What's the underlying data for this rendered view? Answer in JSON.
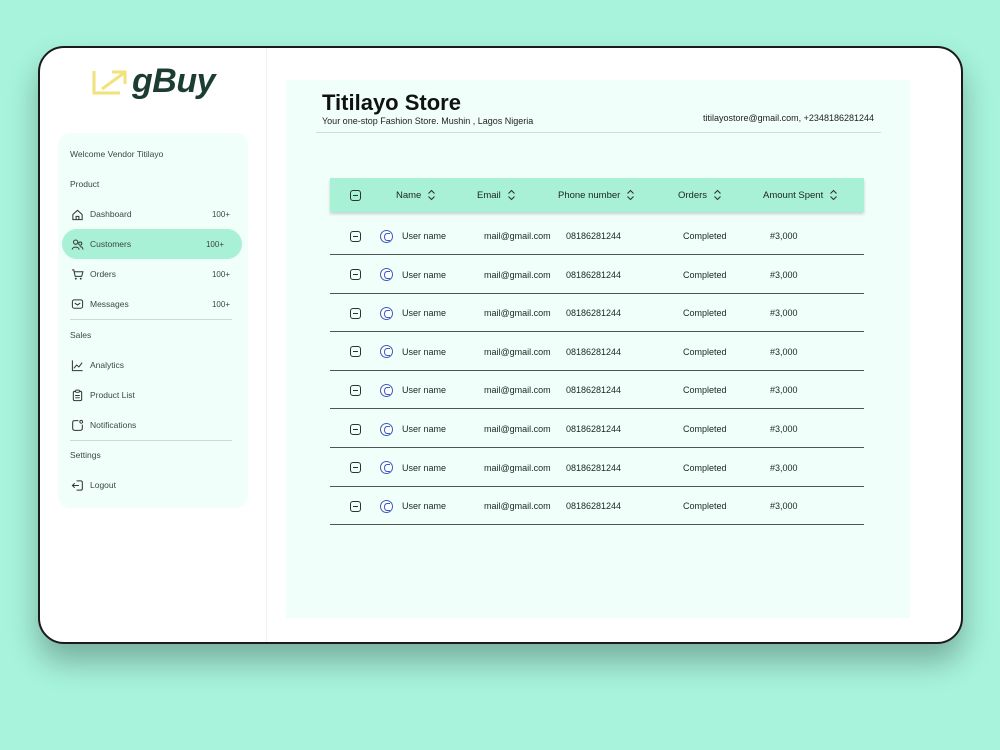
{
  "brand": {
    "logo_text": "gBuy"
  },
  "sidebar": {
    "welcome": "Welcome Vendor Titilayo",
    "sections": {
      "product": "Product",
      "sales": "Sales",
      "settings": "Settings"
    },
    "items": [
      {
        "label": "Dashboard",
        "count": "100+",
        "icon": "home-icon"
      },
      {
        "label": "Customers",
        "count": "100+",
        "icon": "users-icon",
        "active": true
      },
      {
        "label": "Orders",
        "count": "100+",
        "icon": "cart-icon"
      },
      {
        "label": "Messages",
        "count": "100+",
        "icon": "message-icon"
      },
      {
        "label": "Analytics",
        "icon": "analytics-icon"
      },
      {
        "label": "Product List",
        "icon": "clipboard-icon"
      },
      {
        "label": "Notifications",
        "icon": "bell-icon"
      },
      {
        "label": "Logout",
        "icon": "logout-icon"
      }
    ]
  },
  "store": {
    "name": "Titilayo Store",
    "tagline": "Your one-stop Fashion Store.  Mushin , Lagos Nigeria",
    "contact": "titilayostore@gmail.com, +2348186281244"
  },
  "table": {
    "columns": [
      "Name",
      "Email",
      "Phone number",
      "Orders",
      "Amount Spent"
    ],
    "rows": [
      {
        "name": "User  name",
        "email": "mail@gmail.com",
        "phone": "08186281244",
        "orders": "Completed",
        "amount": "#3,000"
      },
      {
        "name": "User  name",
        "email": "mail@gmail.com",
        "phone": "08186281244",
        "orders": "Completed",
        "amount": "#3,000"
      },
      {
        "name": "User  name",
        "email": "mail@gmail.com",
        "phone": "08186281244",
        "orders": "Completed",
        "amount": "#3,000"
      },
      {
        "name": "User  name",
        "email": "mail@gmail.com",
        "phone": "08186281244",
        "orders": "Completed",
        "amount": "#3,000"
      },
      {
        "name": "User  name",
        "email": "mail@gmail.com",
        "phone": "08186281244",
        "orders": "Completed",
        "amount": "#3,000"
      },
      {
        "name": "User  name",
        "email": "mail@gmail.com",
        "phone": "08186281244",
        "orders": "Completed",
        "amount": "#3,000"
      },
      {
        "name": "User  name",
        "email": "mail@gmail.com",
        "phone": "08186281244",
        "orders": "Completed",
        "amount": "#3,000"
      },
      {
        "name": "User  name",
        "email": "mail@gmail.com",
        "phone": "08186281244",
        "orders": "Completed",
        "amount": "#3,000"
      }
    ]
  },
  "colors": {
    "background": "#a7f3dc",
    "accent": "#a8f0d6",
    "panel": "#f1fffa",
    "logo_arrow": "#f2e27a",
    "logo_text": "#1d3d33"
  }
}
